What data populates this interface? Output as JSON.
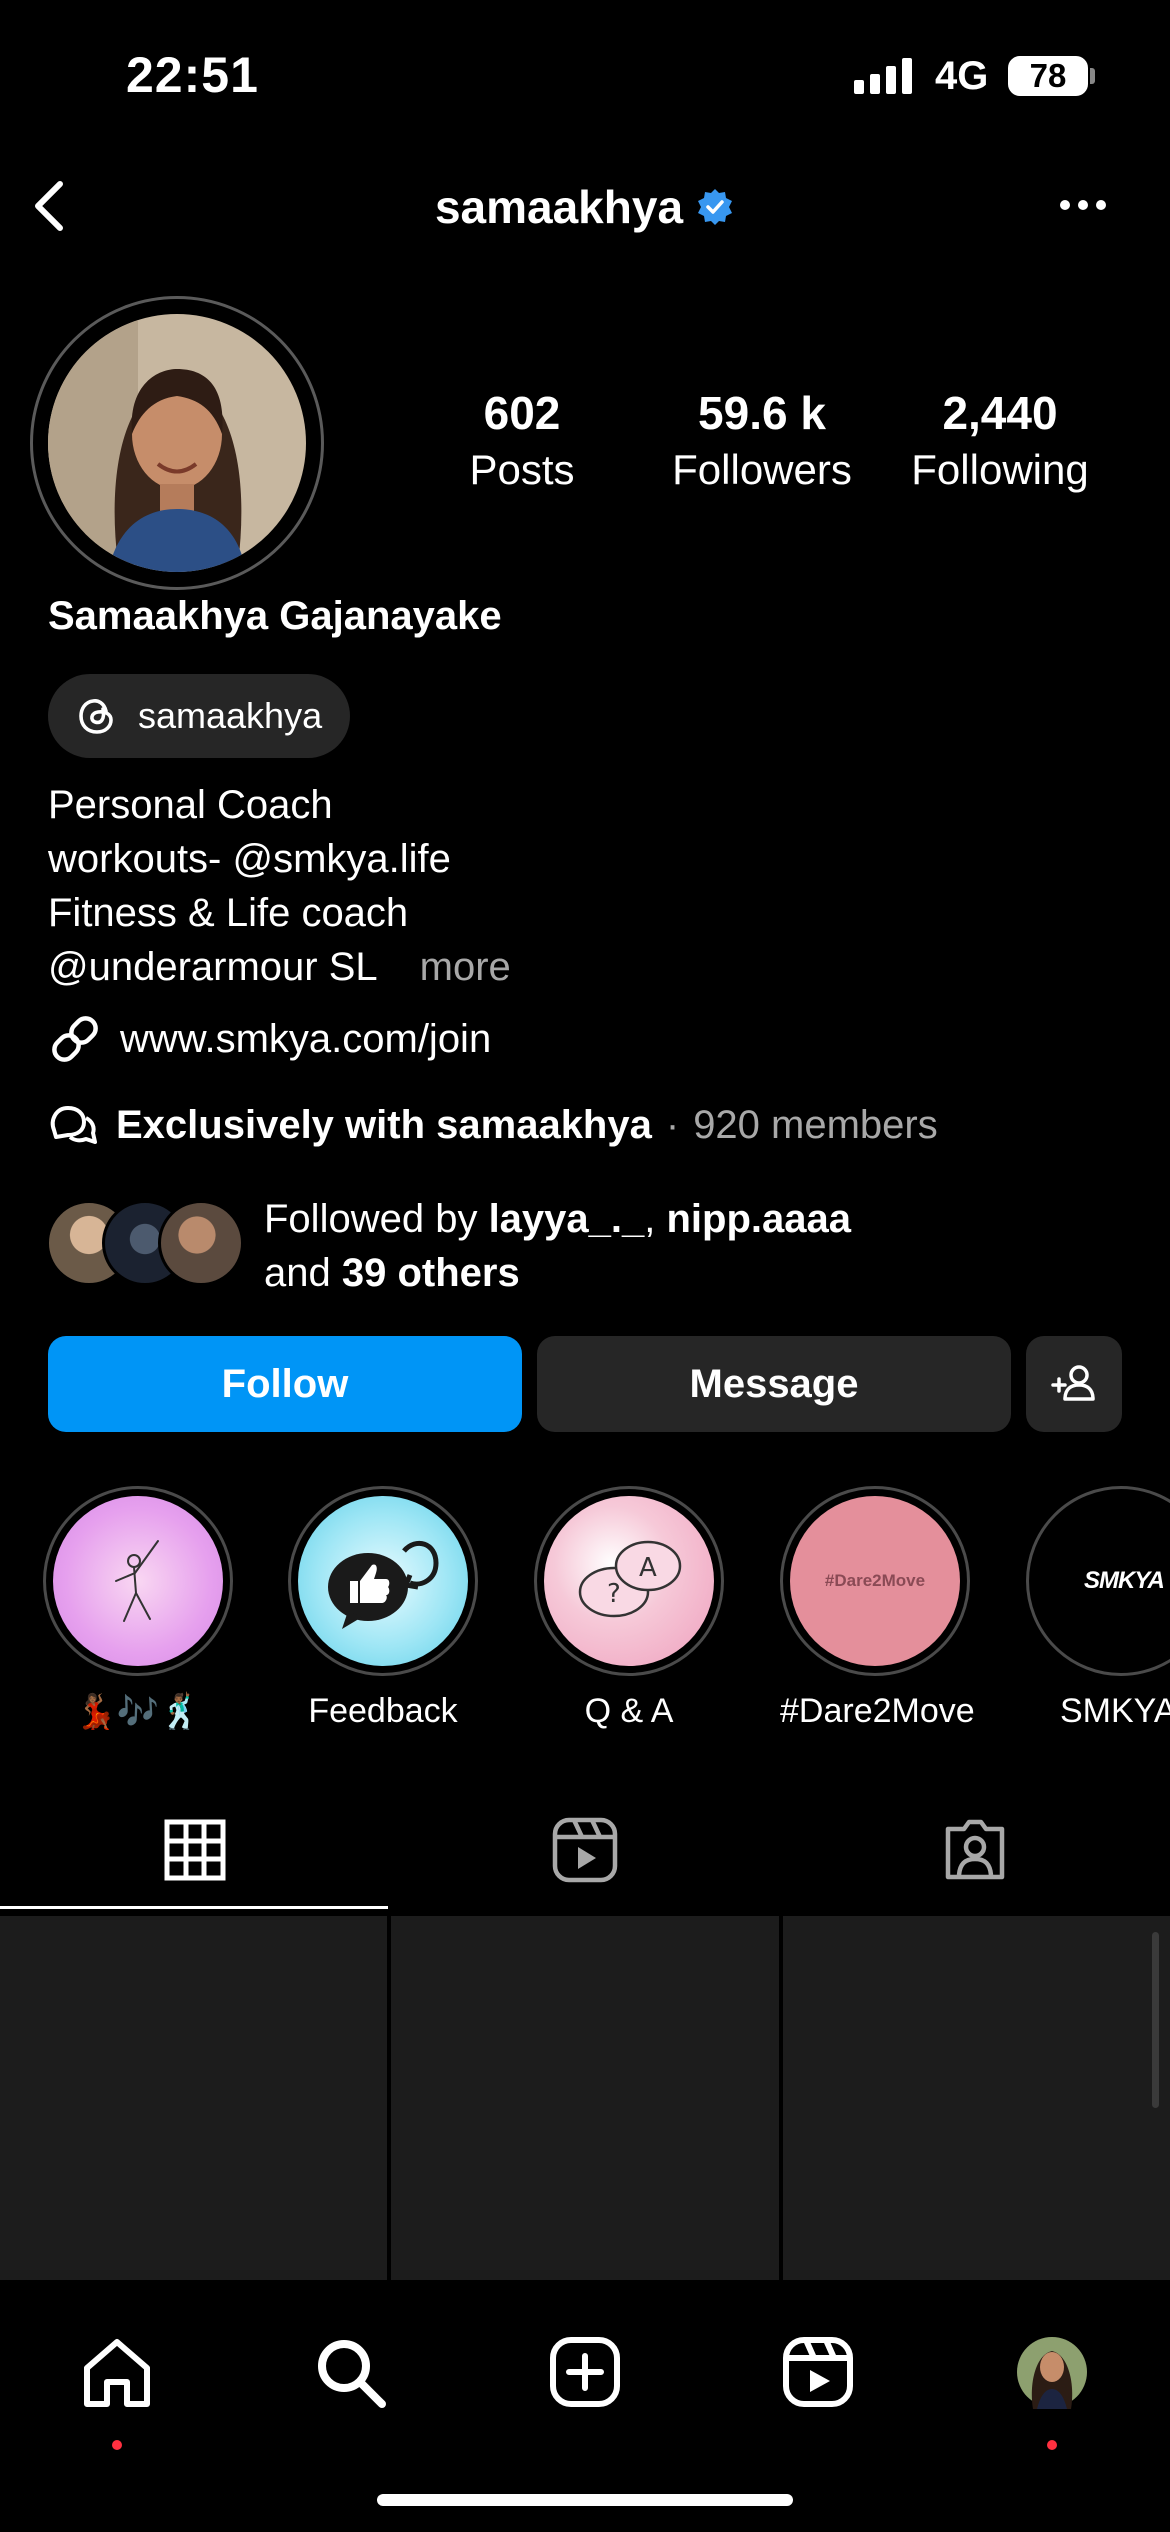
{
  "status_bar": {
    "time": "22:51",
    "network": "4G",
    "battery": "78"
  },
  "header": {
    "username": "samaakhya",
    "verified": true
  },
  "profile": {
    "full_name": "Samaakhya Gajanayake",
    "threads_handle": "samaakhya",
    "stats": [
      {
        "value": "602",
        "label": "Posts"
      },
      {
        "value": "59.6 k",
        "label": "Followers"
      },
      {
        "value": "2,440",
        "label": "Following"
      }
    ],
    "bio": {
      "line1": "Personal Coach",
      "line2": "workouts- @smkya.life",
      "line3": "Fitness & Life coach",
      "line4": "@underarmour SL",
      "more": "more"
    },
    "link": "www.smkya.com/join",
    "channel": {
      "name": "Exclusively with samaakhya",
      "separator": "·",
      "members": "920 members"
    },
    "followed_by": {
      "prefix": "Followed by ",
      "user1": "layya_._",
      "sep": ", ",
      "user2": "nipp.aaaa",
      "and": "and ",
      "others": "39 others"
    }
  },
  "actions": {
    "follow": "Follow",
    "message": "Message"
  },
  "highlights": [
    {
      "caption": "💃🏾🎶🕺🏾"
    },
    {
      "caption": "Feedback"
    },
    {
      "caption": "Q & A"
    },
    {
      "caption": "#Dare2Move",
      "cover_text": "#Dare2Move"
    },
    {
      "caption": "SMKYA",
      "cover_text": "SMKYA"
    }
  ],
  "colors": {
    "accent": "#0095f6",
    "verified": "#3897f0",
    "notification": "#ff3040"
  }
}
